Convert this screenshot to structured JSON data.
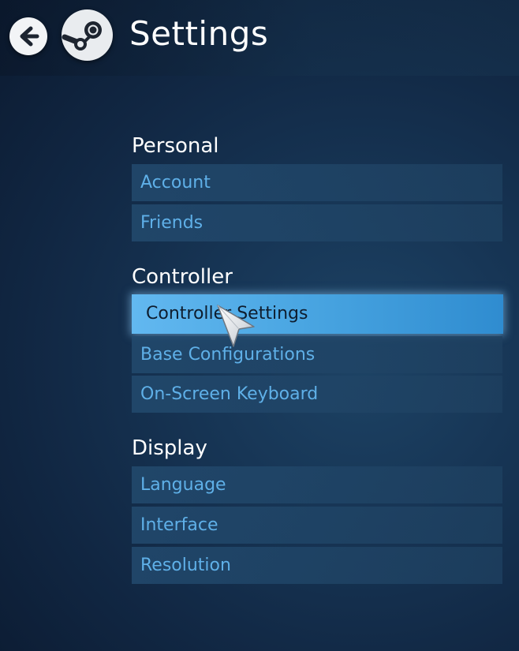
{
  "header": {
    "title": "Settings",
    "back_icon": "arrow-left-icon",
    "logo_icon": "steam-logo-icon"
  },
  "sections": [
    {
      "label": "Personal",
      "items": [
        {
          "label": "Account",
          "selected": false
        },
        {
          "label": "Friends",
          "selected": false
        }
      ]
    },
    {
      "label": "Controller",
      "items": [
        {
          "label": "Controller Settings",
          "selected": true
        },
        {
          "label": "Base Configurations",
          "selected": false
        },
        {
          "label": "On-Screen Keyboard",
          "selected": false
        }
      ]
    },
    {
      "label": "Display",
      "items": [
        {
          "label": "Language",
          "selected": false
        },
        {
          "label": "Interface",
          "selected": false
        },
        {
          "label": "Resolution",
          "selected": false
        }
      ]
    }
  ],
  "colors": {
    "item_text": "#5fb0e8",
    "selected_bg": "#4aa6e2",
    "selected_text": "#0e1d2e",
    "heading_text": "#ffffff"
  },
  "cursor_icon": "pointer-cursor-icon"
}
